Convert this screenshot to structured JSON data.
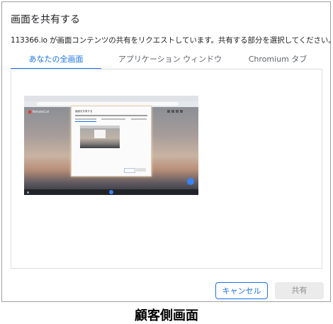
{
  "dialog": {
    "title": "画面を共有する",
    "subtitle": "113366.io が画面コンテンツの共有をリクエストしています。共有する部分を選択してください。",
    "tabs": [
      {
        "label": "あなたの全画面",
        "active": true
      },
      {
        "label": "アプリケーション ウィンドウ",
        "active": false
      },
      {
        "label": "Chromium タブ",
        "active": false
      }
    ],
    "preview": {
      "brand": "RemoteCall"
    },
    "buttons": {
      "cancel": "キャンセル",
      "share": "共有"
    }
  },
  "caption": "顧客側画面",
  "colors": {
    "accent": "#1a73e8",
    "disabled_bg": "#ebebeb",
    "disabled_text": "#8e8e8e"
  }
}
